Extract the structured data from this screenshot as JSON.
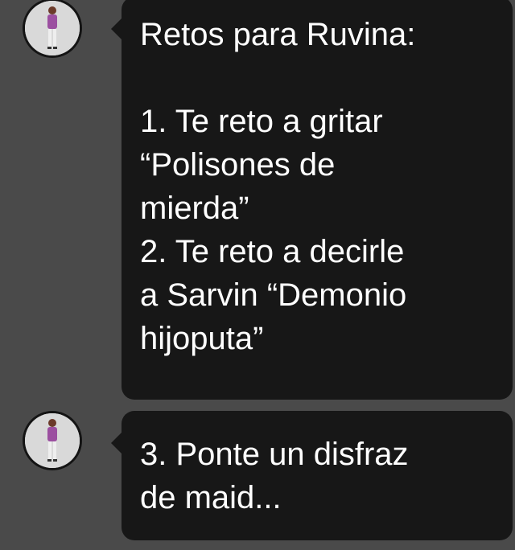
{
  "messages": [
    {
      "sender_avatar": "user-avatar",
      "lines": [
        "Retos para Ruvina:",
        "",
        "1. Te reto a gritar",
        "“Polisones de",
        "mierda”",
        "2. Te reto a decirle",
        "a Sarvin “Demonio",
        "hijoputa”"
      ]
    },
    {
      "sender_avatar": "user-avatar",
      "lines": [
        "3. Ponte un disfraz",
        "de maid..."
      ]
    }
  ],
  "colors": {
    "background": "#4a4a4a",
    "bubble": "#171717",
    "text": "#ffffff"
  }
}
